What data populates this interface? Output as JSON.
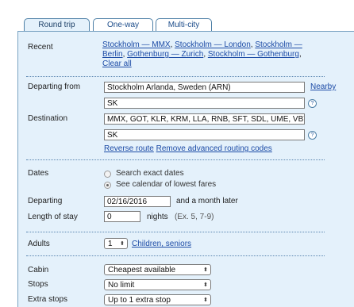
{
  "tabs": [
    "Round trip",
    "One-way",
    "Multi-city"
  ],
  "recent": {
    "label": "Recent",
    "links": [
      "Stockholm — MMX",
      "Stockholm — London",
      "Stockholm — Berlin",
      "Gothenburg — Zurich",
      "Stockholm — Gothenburg"
    ],
    "clear_all": "Clear all"
  },
  "departing_from": {
    "label": "Departing from",
    "value": "Stockholm Arlanda, Sweden (ARN)",
    "nearby": "Nearby",
    "carrier": "SK"
  },
  "destination": {
    "label": "Destination",
    "value": "MMX, GOT, KLR, KRM, LLA, RNB, SFT, SDL, UME, VBY,",
    "carrier": "SK",
    "reverse_route": "Reverse route",
    "remove_routing": "Remove advanced routing codes"
  },
  "help_glyph": "?",
  "dates": {
    "label": "Dates",
    "option_exact": "Search exact dates",
    "option_calendar": "See calendar of lowest fares",
    "selected": "calendar"
  },
  "departing": {
    "label": "Departing",
    "value": "02/16/2016",
    "suffix": "and a month later"
  },
  "length_of_stay": {
    "label": "Length of stay",
    "value": "0",
    "unit": "nights",
    "hint": "(Ex. 5, 7-9)"
  },
  "adults": {
    "label": "Adults",
    "value": "1",
    "link": "Children, seniors"
  },
  "cabin": {
    "label": "Cabin",
    "value": "Cheapest available"
  },
  "stops": {
    "label": "Stops",
    "value": "No limit"
  },
  "extra_stops": {
    "label": "Extra stops",
    "value": "Up to 1 extra stop"
  },
  "icons": {
    "select_arrow": "⬍"
  }
}
